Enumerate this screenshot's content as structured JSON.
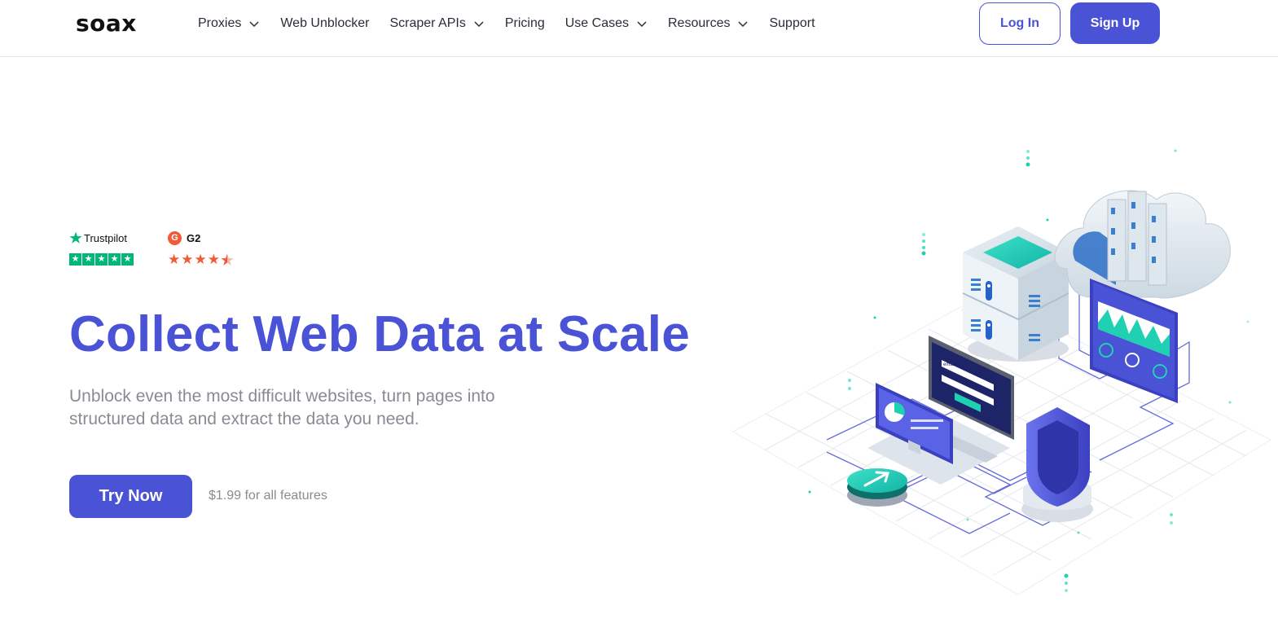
{
  "brand": {
    "logo_text": "soax",
    "accent": "#4a52d6"
  },
  "nav": {
    "items": [
      {
        "label": "Proxies",
        "has_dropdown": true
      },
      {
        "label": "Web Unblocker",
        "has_dropdown": false
      },
      {
        "label": "Scraper APIs",
        "has_dropdown": true
      },
      {
        "label": "Pricing",
        "has_dropdown": false
      },
      {
        "label": "Use Cases",
        "has_dropdown": true
      },
      {
        "label": "Resources",
        "has_dropdown": true
      },
      {
        "label": "Support",
        "has_dropdown": false
      }
    ],
    "login_label": "Log In",
    "signup_label": "Sign Up"
  },
  "ratings": {
    "trustpilot": {
      "name": "Trustpilot",
      "stars": 5,
      "color": "#00b67a"
    },
    "g2": {
      "name": "G2",
      "badge": "G",
      "stars": 4.5,
      "color": "#ef5b35"
    }
  },
  "hero": {
    "title": "Collect Web Data at Scale",
    "subtitle": "Unblock even the most difficult websites, turn pages into structured data and extract the data you need.",
    "cta_label": "Try Now",
    "price_note": "$1.99 for all features"
  },
  "illustration": {
    "laptop_field_label": "email"
  }
}
